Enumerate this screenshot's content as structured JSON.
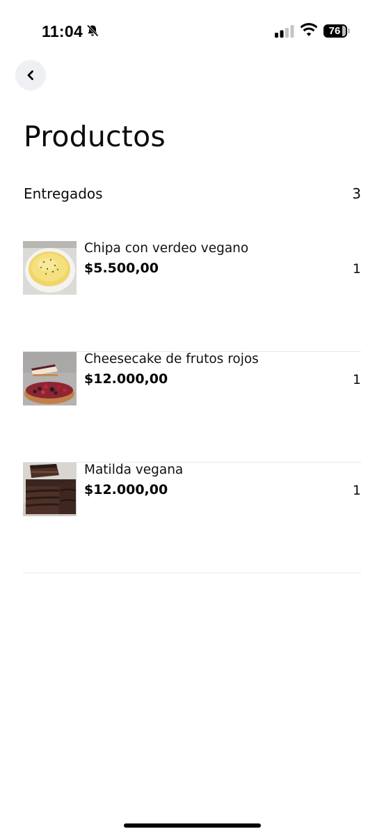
{
  "status_bar": {
    "time": "11:04",
    "battery": "76",
    "icons": [
      "bell-slash-icon",
      "signal-icon",
      "wifi-icon",
      "battery-icon"
    ]
  },
  "header": {
    "back_icon": "chevron-left-icon",
    "title": "Productos"
  },
  "section": {
    "label": "Entregados",
    "count": "3"
  },
  "products": [
    {
      "name": "Chipa con verdeo vegano",
      "price": "$5.500,00",
      "quantity": "1",
      "image": "chipa-image"
    },
    {
      "name": "Cheesecake de frutos rojos",
      "price": "$12.000,00",
      "quantity": "1",
      "image": "cheesecake-image"
    },
    {
      "name": "Matilda vegana",
      "price": "$12.000,00",
      "quantity": "1",
      "image": "chocolate-cake-image"
    }
  ]
}
